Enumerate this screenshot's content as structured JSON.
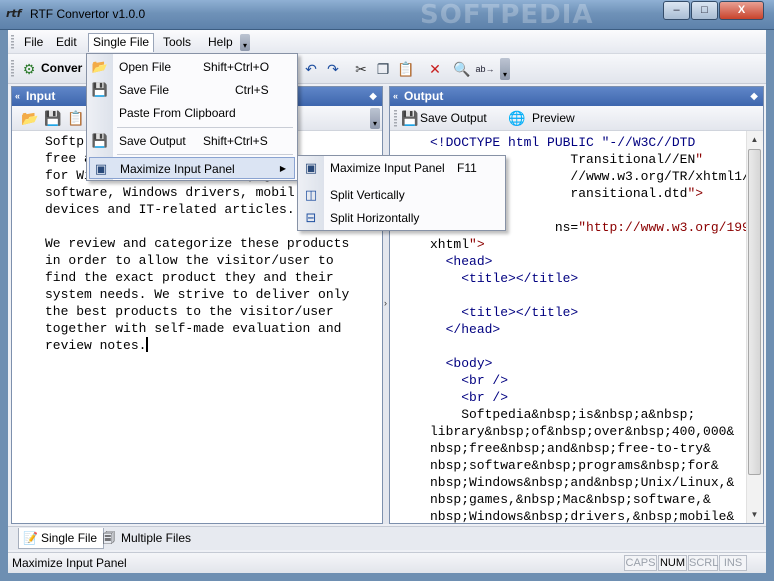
{
  "window": {
    "title": "RTF Convertor v1.0.0",
    "app_icon_text": "rtf",
    "watermark": "SOFTPEDIA",
    "min_glyph": "–",
    "max_glyph": "□",
    "close_glyph": "X"
  },
  "menubar": {
    "items": [
      "File",
      "Edit",
      "Single File",
      "Tools",
      "Help"
    ],
    "active": "Single File"
  },
  "toolbar": {
    "convert_label": "Conver",
    "icons": [
      "undo-icon",
      "redo-icon",
      "cut-icon",
      "copy-icon",
      "paste-icon",
      "delete-icon",
      "find-icon",
      "replace-icon"
    ]
  },
  "single_file_menu": {
    "items": [
      {
        "label": "Open File",
        "shortcut": "Shift+Ctrl+O",
        "icon": "open-folder-icon"
      },
      {
        "label": "Save File",
        "shortcut": "Ctrl+S",
        "icon": "save-icon"
      },
      {
        "label": "Paste From Clipboard",
        "shortcut": "",
        "icon": ""
      },
      {
        "label": "Save Output",
        "shortcut": "Shift+Ctrl+S",
        "icon": "save-output-icon"
      },
      {
        "label": "Maximize Input Panel",
        "shortcut": "",
        "icon": "maximize-panel-icon"
      }
    ]
  },
  "maximize_submenu": {
    "items": [
      {
        "label": "Maximize Input Panel",
        "shortcut": "F11",
        "icon": "maximize-panel-icon"
      },
      {
        "label": "Split Vertically",
        "shortcut": "",
        "icon": "split-vertical-icon"
      },
      {
        "label": "Split Horizontally",
        "shortcut": "",
        "icon": "split-horizontal-icon"
      }
    ]
  },
  "input_panel": {
    "title": "Input",
    "lines": [
      "Softp",
      "free and free-to-try software pr",
      "for Windows and Unix/Linux, game",
      "software, Windows drivers, mobil",
      "devices and IT-related articles.",
      "",
      "We review and categorize these products",
      "in order to allow the visitor/user to",
      "find the exact product they and their",
      "system needs. We strive to deliver only",
      "the best products to the visitor/user",
      "together with self-made evaluation and",
      "review notes."
    ]
  },
  "output_panel": {
    "title": "Output",
    "save_output_label": "Save Output",
    "preview_label": "Preview",
    "lines": [
      "<!DOCTYPE html PUBLIC \"-//W3C//DTD",
      "                  Transitional//EN\"",
      "                  //www.w3.org/TR/xhtml1/DTD/",
      "                  ransitional.dtd\">",
      "",
      "                ns=\"http://www.w3.org/1999/",
      "xhtml\">",
      "  <head>",
      "    <title></title>",
      "",
      "    <title></title>",
      "  </head>",
      "",
      "  <body>",
      "    <br />",
      "    <br />",
      "    Softpedia&nbsp;is&nbsp;a&nbsp;",
      "library&nbsp;of&nbsp;over&nbsp;400,000&",
      "nbsp;free&nbsp;and&nbsp;free-to-try&",
      "nbsp;software&nbsp;programs&nbsp;for&",
      "nbsp;Windows&nbsp;and&nbsp;Unix/Linux,&",
      "nbsp;games,&nbsp;Mac&nbsp;software,&",
      "nbsp;Windows&nbsp;drivers,&nbsp;mobile&"
    ]
  },
  "tabs": [
    {
      "label": "Single File",
      "active": true
    },
    {
      "label": "Multiple Files",
      "active": false
    }
  ],
  "statusbar": {
    "text": "Maximize Input Panel",
    "indicators": [
      {
        "label": "CAPS",
        "on": false
      },
      {
        "label": "NUM",
        "on": true
      },
      {
        "label": "SCRL",
        "on": false
      },
      {
        "label": "INS",
        "on": false
      }
    ]
  }
}
